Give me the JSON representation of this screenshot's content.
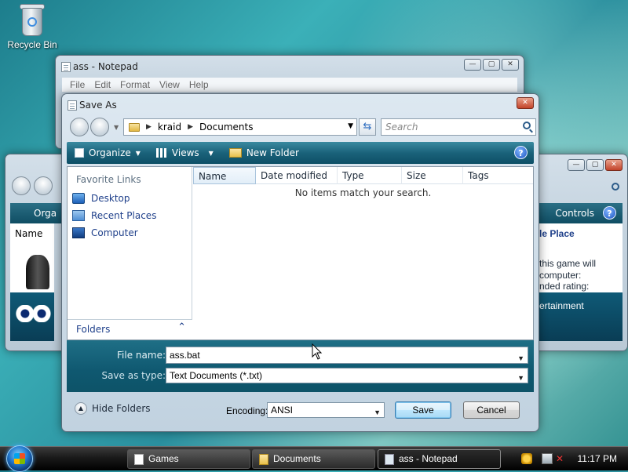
{
  "desktop": {
    "recycle_bin_label": "Recycle Bin"
  },
  "notepad": {
    "title": "ass - Notepad",
    "menu": [
      "File",
      "Edit",
      "Format",
      "View",
      "Help"
    ]
  },
  "games_window": {
    "toolbar_left": "Orga",
    "column_left": "Name",
    "toolbar_right": "Controls",
    "place_text": "le Place",
    "info_line1": "this game will",
    "info_line2": "computer:",
    "info_line3": "nded rating:",
    "entertainment": "ertainment"
  },
  "save_dialog": {
    "title": "Save As",
    "address": {
      "crumbs": [
        "kraid",
        "Documents"
      ]
    },
    "search": {
      "placeholder": "Search"
    },
    "toolbar": {
      "organize": "Organize",
      "views": "Views",
      "new_folder": "New Folder",
      "help": "?"
    },
    "nav": {
      "favorite_links_title": "Favorite Links",
      "items": [
        "Desktop",
        "Recent Places",
        "Computer"
      ],
      "folders_label": "Folders"
    },
    "columns": [
      "Name",
      "Date modified",
      "Type",
      "Size",
      "Tags"
    ],
    "empty_message": "No items match your search.",
    "file_name_label": "File name:",
    "file_name_value": "ass.bat",
    "save_as_type_label": "Save as type:",
    "save_as_type_value": "Text Documents (*.txt)",
    "hide_folders": "Hide Folders",
    "encoding_label": "Encoding:",
    "encoding_value": "ANSI",
    "save_button": "Save",
    "cancel_button": "Cancel"
  },
  "taskbar": {
    "buttons": [
      "Games",
      "Documents",
      "ass - Notepad"
    ],
    "clock": "11:17 PM"
  },
  "colors": {
    "aero_band": "#0f4d63",
    "link_blue": "#1e3f8a"
  }
}
